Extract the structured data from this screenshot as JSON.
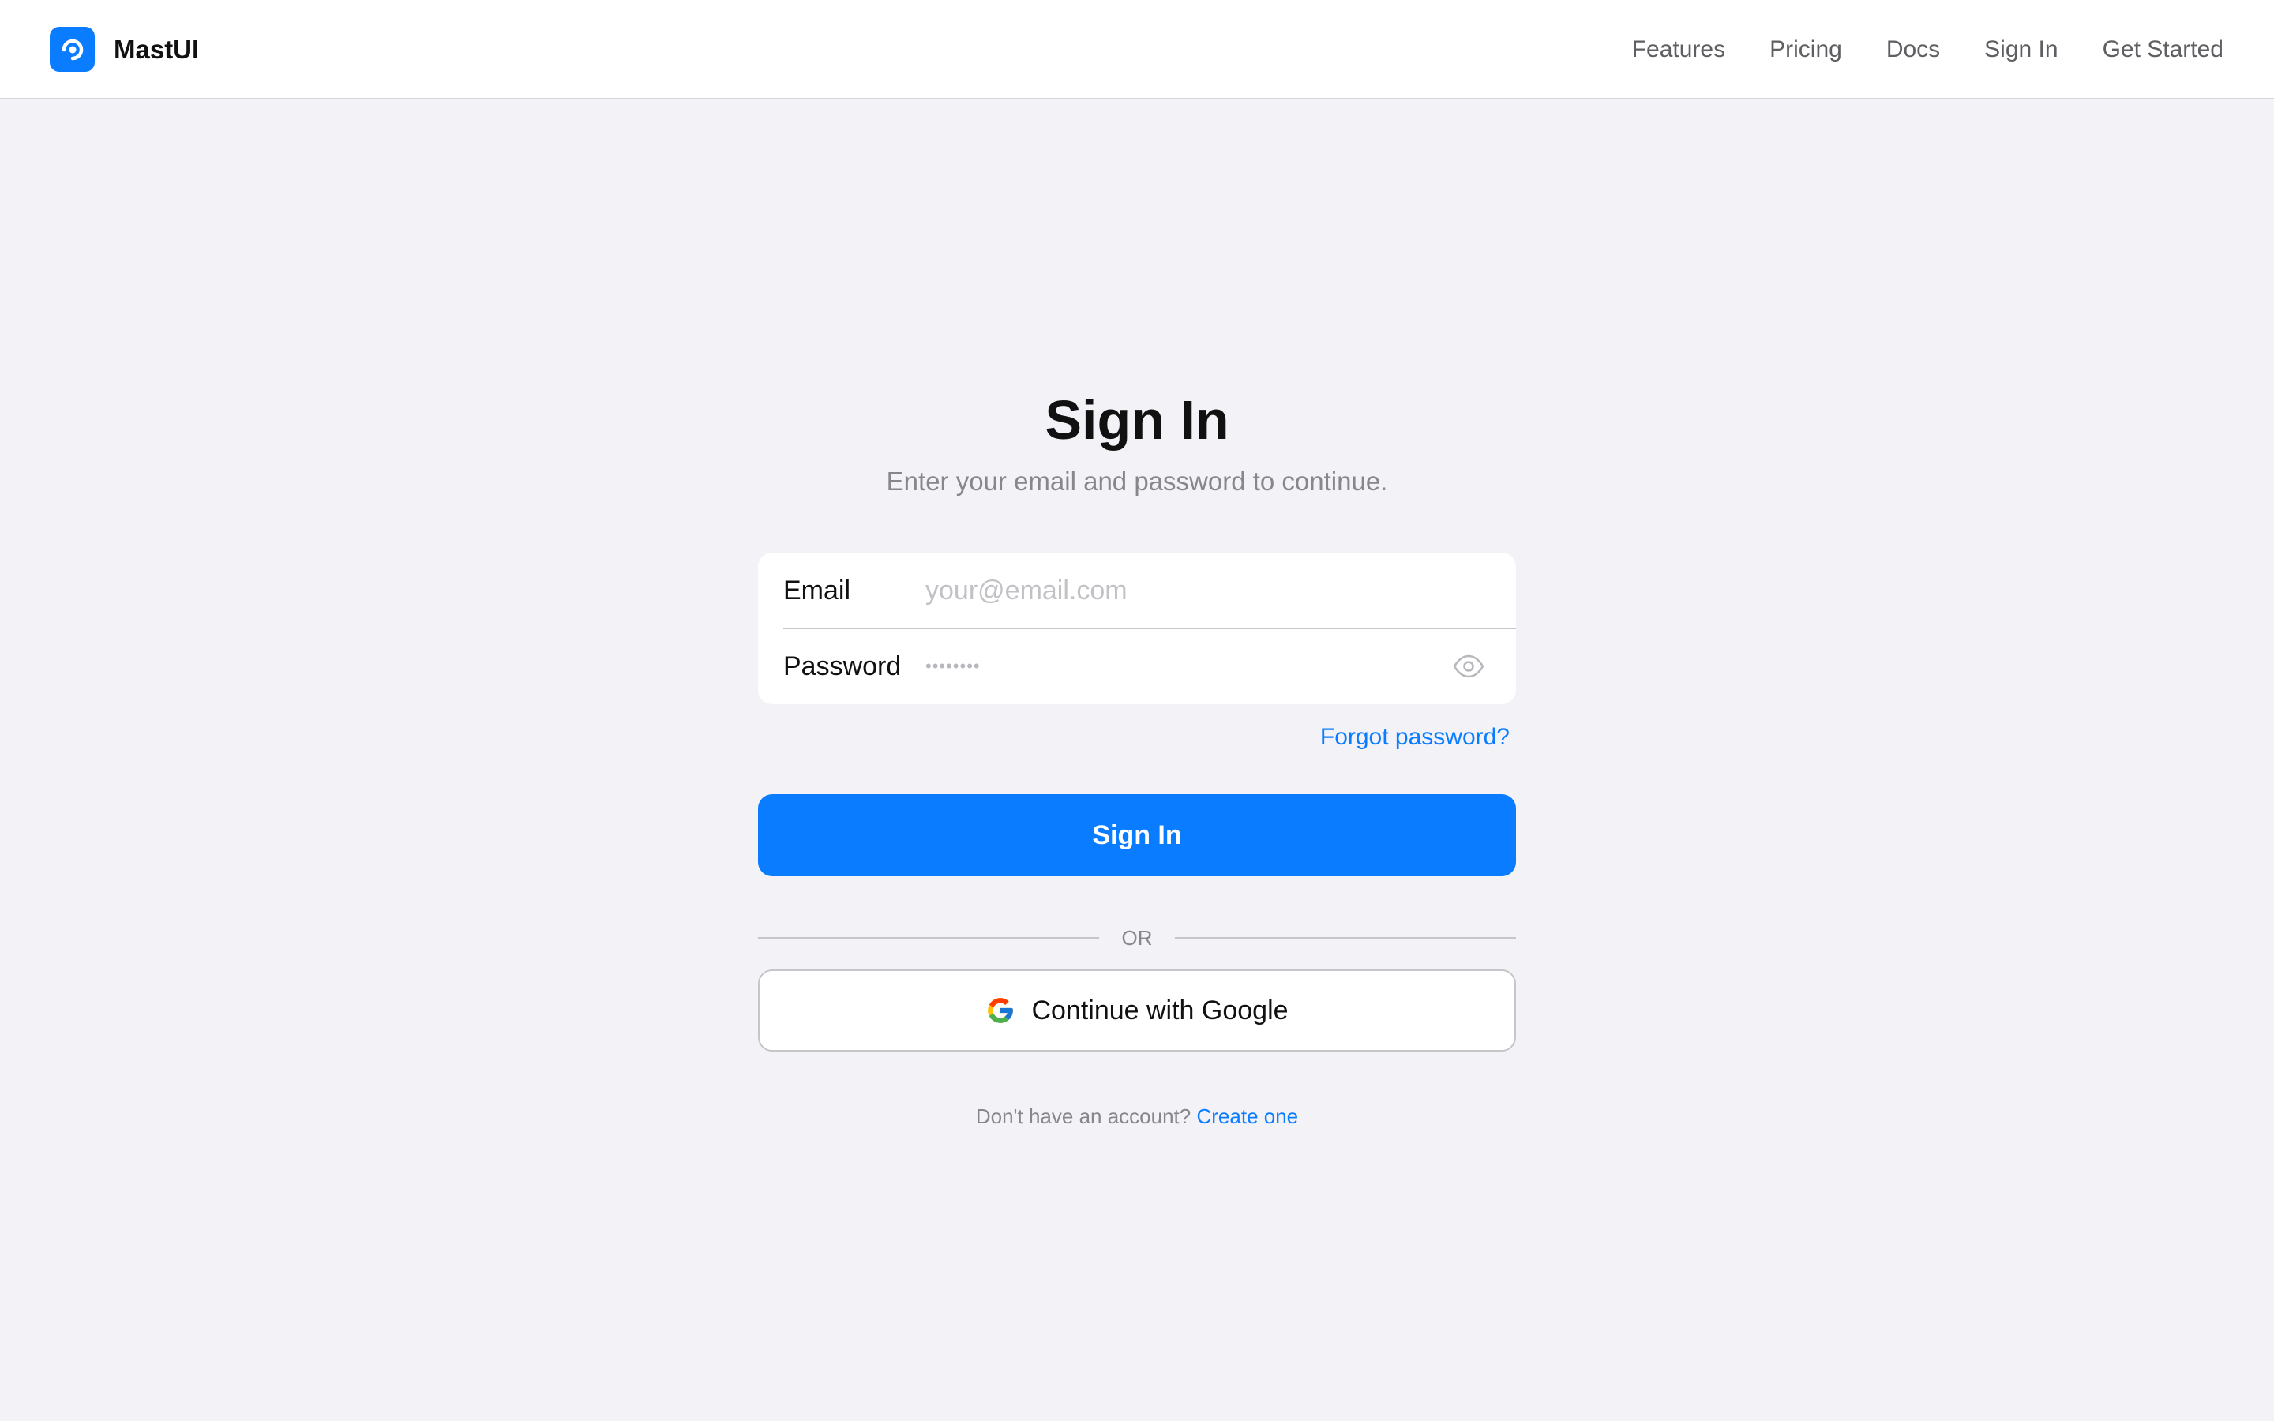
{
  "header": {
    "brand_name": "MastUI",
    "nav": [
      "Features",
      "Pricing",
      "Docs",
      "Sign In",
      "Get Started"
    ]
  },
  "main": {
    "title": "Sign In",
    "subtitle": "Enter your email and password to continue.",
    "email": {
      "label": "Email",
      "placeholder": "your@email.com",
      "value": ""
    },
    "password": {
      "label": "Password",
      "masked_value": "••••••••",
      "toggle_icon": "eye-icon"
    },
    "forgot_password": "Forgot password?",
    "sign_in_button": "Sign In",
    "divider": "OR",
    "google_button": "Continue with Google",
    "footer_prompt": "Don't have an account?",
    "footer_link": "Create one"
  },
  "colors": {
    "accent": "#0a7cff",
    "background": "#f2f2f7",
    "muted_text": "#86868b"
  }
}
